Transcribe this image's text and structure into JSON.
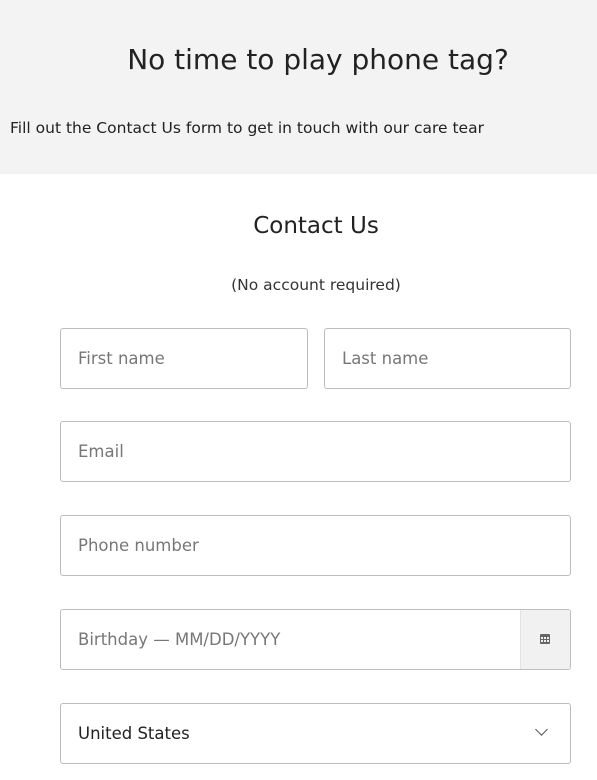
{
  "banner": {
    "title": "No time to play phone tag?",
    "subtitle": "Fill out the Contact Us form to get in touch with our care tear"
  },
  "form": {
    "title": "Contact Us",
    "note": "(No account required)",
    "fields": {
      "first_name": {
        "placeholder": "First name",
        "value": ""
      },
      "last_name": {
        "placeholder": "Last name",
        "value": ""
      },
      "email": {
        "placeholder": "Email",
        "value": ""
      },
      "phone": {
        "placeholder": "Phone number",
        "value": ""
      },
      "birthday": {
        "placeholder": "Birthday — MM/DD/YYYY",
        "value": "",
        "icon": "calendar-icon"
      },
      "country": {
        "selected": "United States",
        "icon": "chevron-down-icon"
      }
    }
  },
  "colors": {
    "banner_background": "#f3f3f3",
    "field_border": "#bdbdbd",
    "placeholder_text": "#777777",
    "text": "#222222"
  }
}
